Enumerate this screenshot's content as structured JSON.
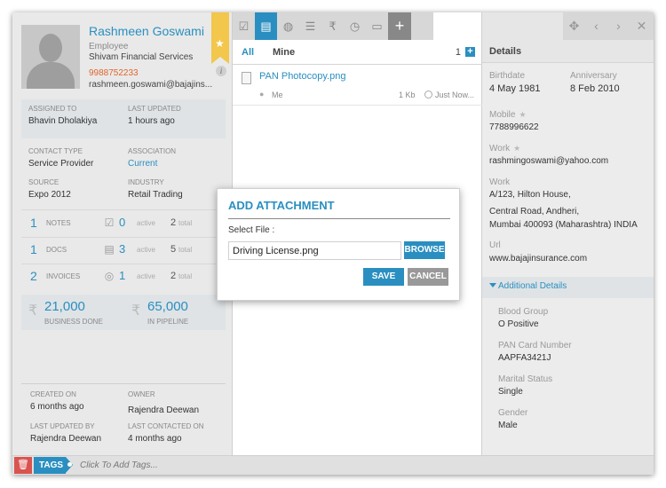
{
  "contact": {
    "name": "Rashmeen Goswami",
    "role": "Employee",
    "company": "Shivam Financial Services",
    "phone": "9988752233",
    "email": "rashmeen.goswami@bajajins..."
  },
  "assignment": {
    "assigned_to_label": "ASSIGNED TO",
    "assigned_to": "Bhavin Dholakiya",
    "last_updated_label": "LAST UPDATED",
    "last_updated": "1 hours ago"
  },
  "profile": {
    "contact_type_label": "CONTACT TYPE",
    "contact_type": "Service Provider",
    "association_label": "ASSOCIATION",
    "association": "Current",
    "source_label": "SOURCE",
    "source": "Expo 2012",
    "industry_label": "INDUSTRY",
    "industry": "Retail Trading"
  },
  "stats": [
    {
      "count": "1",
      "label": "NOTES",
      "icon": "checkbox-icon",
      "active": "0",
      "active_label": "active",
      "total": "2",
      "total_label": "total"
    },
    {
      "count": "1",
      "label": "DOCS",
      "icon": "briefcase-icon",
      "active": "3",
      "active_label": "active",
      "total": "5",
      "total_label": "total"
    },
    {
      "count": "2",
      "label": "INVOICES",
      "icon": "invoice-icon",
      "active": "1",
      "active_label": "active",
      "total": "2",
      "total_label": "total"
    }
  ],
  "money": {
    "business_done": "21,000",
    "business_done_label": "BUSINESS DONE",
    "in_pipeline": "65,000",
    "in_pipeline_label": "IN PIPELINE",
    "currency_symbol": "₹"
  },
  "meta": {
    "created_on_label": "CREATED ON",
    "created_on": "6 months ago",
    "owner_label": "OWNER",
    "owner": "Rajendra Deewan",
    "last_updated_by_label": "LAST UPDATED BY",
    "last_updated_by": "Rajendra Deewan",
    "last_contacted_label": "LAST CONTACTED ON",
    "last_contacted": "4 months ago"
  },
  "tags": {
    "label": "TAGS",
    "placeholder": "Click To Add Tags..."
  },
  "toolbar": {
    "icons": [
      "checklist-icon",
      "document-icon",
      "globe-icon",
      "file-list-icon",
      "rupee-icon",
      "history-icon",
      "chat-icon",
      "plus-icon"
    ],
    "active_index": 1,
    "plus": "+"
  },
  "file_tabs": {
    "all": "All",
    "mine": "Mine",
    "count": "1"
  },
  "files": [
    {
      "name": "PAN Photocopy.png",
      "owner": "Me",
      "size": "1 Kb",
      "time": "Just Now..."
    }
  ],
  "details": {
    "title": "Details",
    "birthdate_label": "Birthdate",
    "birthdate": "4 May 1981",
    "anniversary_label": "Anniversary",
    "anniversary": "8 Feb 2010",
    "mobile_label": "Mobile",
    "mobile": "7788996622",
    "work_email_label": "Work",
    "work_email": "rashmingoswami@yahoo.com",
    "work_address_label": "Work",
    "work_address_1": "A/123, Hilton House,",
    "work_address_2": "Central Road, Andheri,",
    "work_address_3": "Mumbai 400093 (Maharashtra) INDIA",
    "url_label": "Url",
    "url": "www.bajajinsurance.com",
    "additional_title": "Additional Details",
    "blood_group_label": "Blood Group",
    "blood_group": "O Positive",
    "pan_label": "PAN Card Number",
    "pan": "AAPFA3421J",
    "marital_label": "Marital Status",
    "marital": "Single",
    "gender_label": "Gender",
    "gender": "Male"
  },
  "modal": {
    "title": "ADD ATTACHMENT",
    "select_label": "Select File :",
    "file_value": "Driving License.png",
    "browse": "BROWSE",
    "save": "SAVE",
    "cancel": "CANCEL"
  },
  "colors": {
    "accent": "#2a8fc0",
    "phone": "#e0662a",
    "bookmark": "#f3c64c",
    "danger": "#d9534f"
  }
}
